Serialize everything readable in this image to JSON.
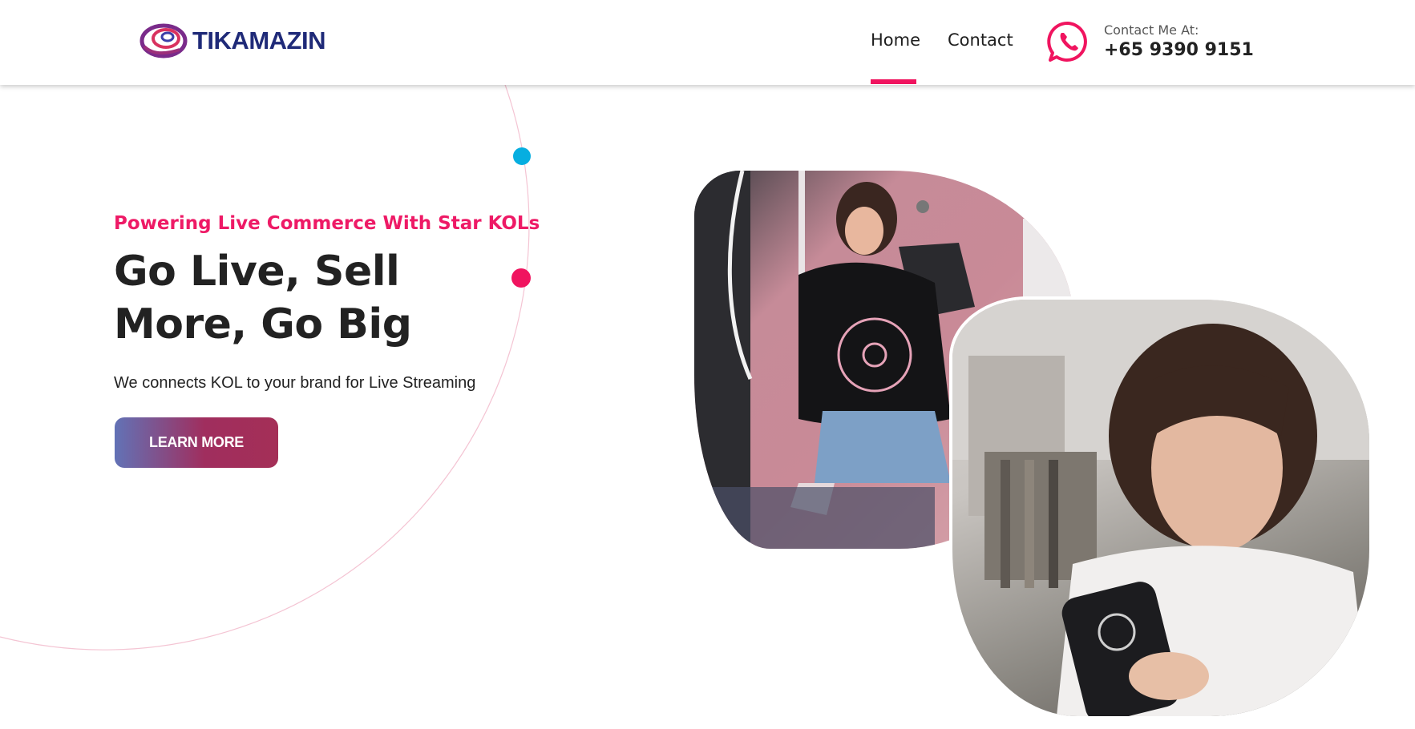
{
  "brand": {
    "name": "TIKAMAZIN",
    "logo_icon": "spiral-logo-icon"
  },
  "nav": {
    "items": [
      {
        "label": "Home",
        "active": true
      },
      {
        "label": "Contact",
        "active": false
      }
    ]
  },
  "contact": {
    "label": "Contact Me At:",
    "phone": "+65 9390 9151",
    "icon": "whatsapp-icon"
  },
  "hero": {
    "tagline": "Powering Live Commerce With Star KOLs",
    "headline": "Go Live, Sell More, Go Big",
    "subline": "We connects KOL to your brand for Live Streaming",
    "cta_label": "LEARN MORE"
  },
  "images": {
    "left": "kol-live-stream-photo",
    "right": "kol-live-stream-photo"
  },
  "colors": {
    "accent_pink": "#f0145f",
    "accent_cyan": "#06aee0",
    "brand_navy": "#1f2a78",
    "cta_gradient_start": "#6272b6",
    "cta_gradient_end": "#a42f57"
  }
}
